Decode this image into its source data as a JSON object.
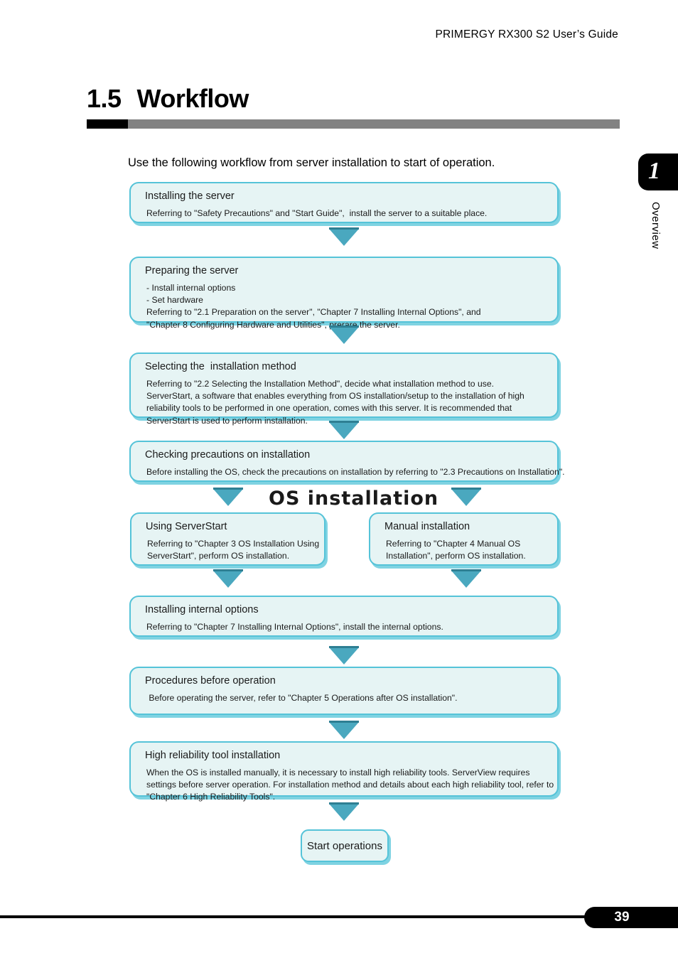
{
  "header": {
    "running_head": "PRIMERGY RX300 S2 User’s Guide"
  },
  "section": {
    "number": "1.5",
    "title": "Workflow"
  },
  "chapter_tab": {
    "number": "1",
    "label": "Overview"
  },
  "intro": "Use the following workflow from server installation to start of operation.",
  "os_banner": "OS installation",
  "flow": {
    "nodes": [
      {
        "id": "installing-the-server",
        "head": "Installing the server",
        "lines": [
          "Referring to \"Safety Precautions\" and \"Start Guide\",  install the server to a suitable place."
        ]
      },
      {
        "id": "preparing-the-server",
        "head": "Preparing the server",
        "lines": [
          "- Install internal options",
          "- Set hardware",
          "Referring to \"2.1 Preparation on the server\", \"Chapter 7 Installing Internal Options\", and",
          "\"Chapter 8 Configuring Hardware and Utilities\", prerare the server."
        ]
      },
      {
        "id": "selecting-the-installation-method",
        "head": "Selecting the  installation method",
        "lines": [
          "Referring to \"2.2 Selecting the Installation Method\", decide what installation method to use.",
          "ServerStart, a software that enables everything from OS installation/setup to the installation of high",
          "reliability tools to be performed in one operation, comes with this server. It is recommended that",
          "ServerStart is used to perform installation."
        ]
      },
      {
        "id": "checking-precautions-on-installation",
        "head": "Checking precautions on installation",
        "lines": [
          "Before installing the OS, check the precautions on installation by referring to \"2.3 Precautions on Installation\"."
        ]
      },
      {
        "id": "using-serverstart",
        "head": "Using ServerStart",
        "lines": [
          "Referring to \"Chapter 3 OS Installation Using",
          "ServerStart\", perform OS installation."
        ]
      },
      {
        "id": "manual-installation",
        "head": "Manual installation",
        "lines": [
          "Referring to \"Chapter 4 Manual OS",
          "Installation\", perform OS installation."
        ]
      },
      {
        "id": "installing-internal-options",
        "head": "Installing internal options",
        "lines": [
          "Referring to \"Chapter 7 Installing Internal Options\", install the internal options."
        ]
      },
      {
        "id": "procedures-before-operation",
        "head": "Procedures before operation",
        "lines": [
          " Before operating the server, refer to \"Chapter 5 Operations after OS installation\"."
        ]
      },
      {
        "id": "high-reliability-tool-installation",
        "head": "High reliability tool installation",
        "lines": [
          "When the OS is installed manually, it is necessary to install high reliability tools. ServerView requires",
          "settings before server operation. For installation method and details about each high reliability tool, refer to",
          "\"Chapter 6 High Reliability Tools\"."
        ]
      }
    ],
    "terminal": "Start operations"
  },
  "footer": {
    "page_number": "39"
  },
  "colors": {
    "node_fill": "#e6f4f4",
    "node_border": "#55c3d8",
    "node_shadow": "#7fd3e2",
    "arrow": "#4aa8bf",
    "rule_gray": "#828282",
    "black": "#000000"
  }
}
